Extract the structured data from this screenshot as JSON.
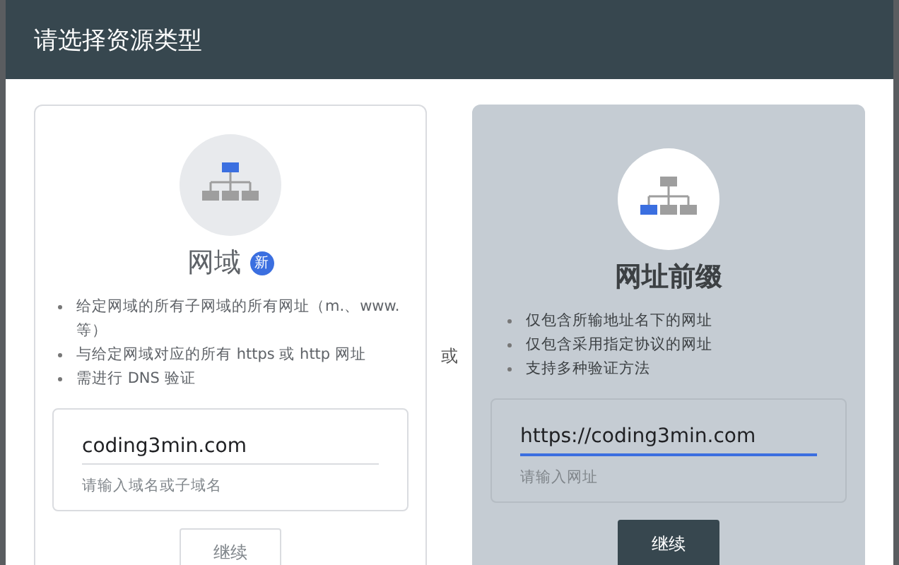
{
  "dialog": {
    "title": "请选择资源类型"
  },
  "separator": "或",
  "options": [
    {
      "kind": "domain",
      "selected": false,
      "title": "网域",
      "badge": "新",
      "bullets": [
        "给定网域的所有子网域的所有网址（m.、www. 等）",
        "与给定网域对应的所有 https 或 http 网址",
        "需进行 DNS 验证"
      ],
      "input": {
        "value": "coding3min.com",
        "helper": "请输入域名或子域名",
        "focused": false
      },
      "button": "继续"
    },
    {
      "kind": "url_prefix",
      "selected": true,
      "title": "网址前缀",
      "bullets": [
        "仅包含所输地址名下的网址",
        "仅包含采用指定协议的网址",
        "支持多种验证方法"
      ],
      "input": {
        "value": "https://coding3min.com",
        "helper": "请输入网址",
        "focused": true
      },
      "button": "继续"
    }
  ]
}
